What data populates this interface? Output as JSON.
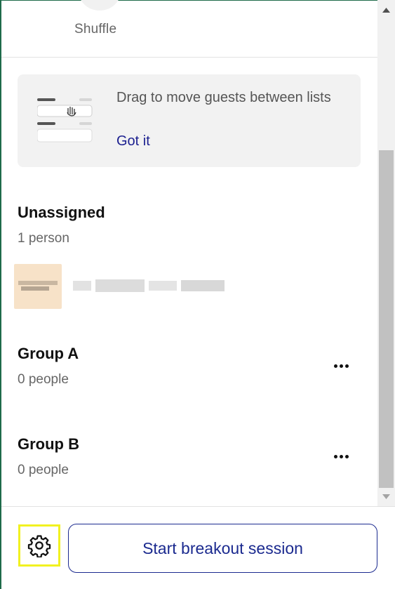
{
  "header": {
    "shuffle_label": "Shuffle"
  },
  "tip": {
    "text": "Drag to move guests between lists",
    "link_label": "Got it"
  },
  "unassigned": {
    "title": "Unassigned",
    "count": "1 person"
  },
  "groups": [
    {
      "title": "Group A",
      "count": "0 people"
    },
    {
      "title": "Group B",
      "count": "0 people"
    }
  ],
  "footer": {
    "start_label": "Start breakout session",
    "settings_icon": "gear-icon"
  },
  "colors": {
    "accent": "#1b2a8f",
    "highlight": "#f1f120"
  }
}
